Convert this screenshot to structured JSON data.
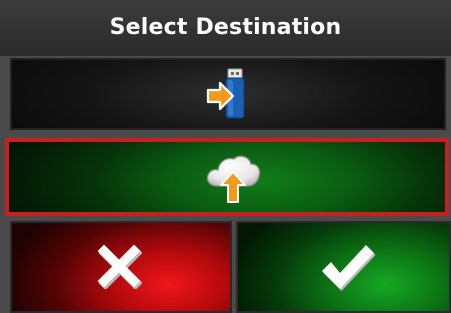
{
  "dialog": {
    "title": "Select Destination"
  },
  "options": [
    {
      "id": "usb",
      "icon": "usb-drive-import-icon",
      "selected": false
    },
    {
      "id": "cloud",
      "icon": "cloud-upload-icon",
      "selected": true
    }
  ],
  "actions": {
    "cancel_icon": "close-icon",
    "confirm_icon": "checkmark-icon"
  },
  "colors": {
    "selection_border": "#c8201f",
    "cancel_accent": "#e0141a",
    "confirm_accent": "#14a020",
    "arrow_orange": "#f39a1d",
    "usb_blue": "#1a5fb4"
  }
}
